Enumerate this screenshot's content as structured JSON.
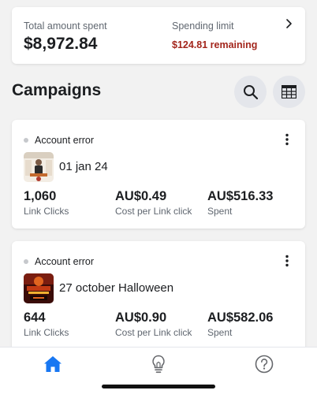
{
  "summary": {
    "total_label": "Total amount spent",
    "total_value": "$8,972.84",
    "limit_label": "Spending limit",
    "limit_value": "$124.81 remaining"
  },
  "campaigns_header": {
    "title": "Campaigns"
  },
  "campaigns": [
    {
      "status": "Account error",
      "name": "01 jan 24",
      "metrics": [
        {
          "value": "1,060",
          "label": "Link Clicks"
        },
        {
          "value": "AU$0.49",
          "label": "Cost per Link click"
        },
        {
          "value": "AU$516.33",
          "label": "Spent"
        }
      ]
    },
    {
      "status": "Account error",
      "name": "27 october Halloween",
      "metrics": [
        {
          "value": "644",
          "label": "Link Clicks"
        },
        {
          "value": "AU$0.90",
          "label": "Cost per Link click"
        },
        {
          "value": "AU$582.06",
          "label": "Spent"
        }
      ]
    }
  ],
  "colors": {
    "accent_blue": "#1877f2",
    "limit_red": "#a3261c",
    "status_dot": "#c6c8cc"
  },
  "nav": {
    "items": [
      "home-icon",
      "lightbulb-icon",
      "help-icon"
    ]
  }
}
